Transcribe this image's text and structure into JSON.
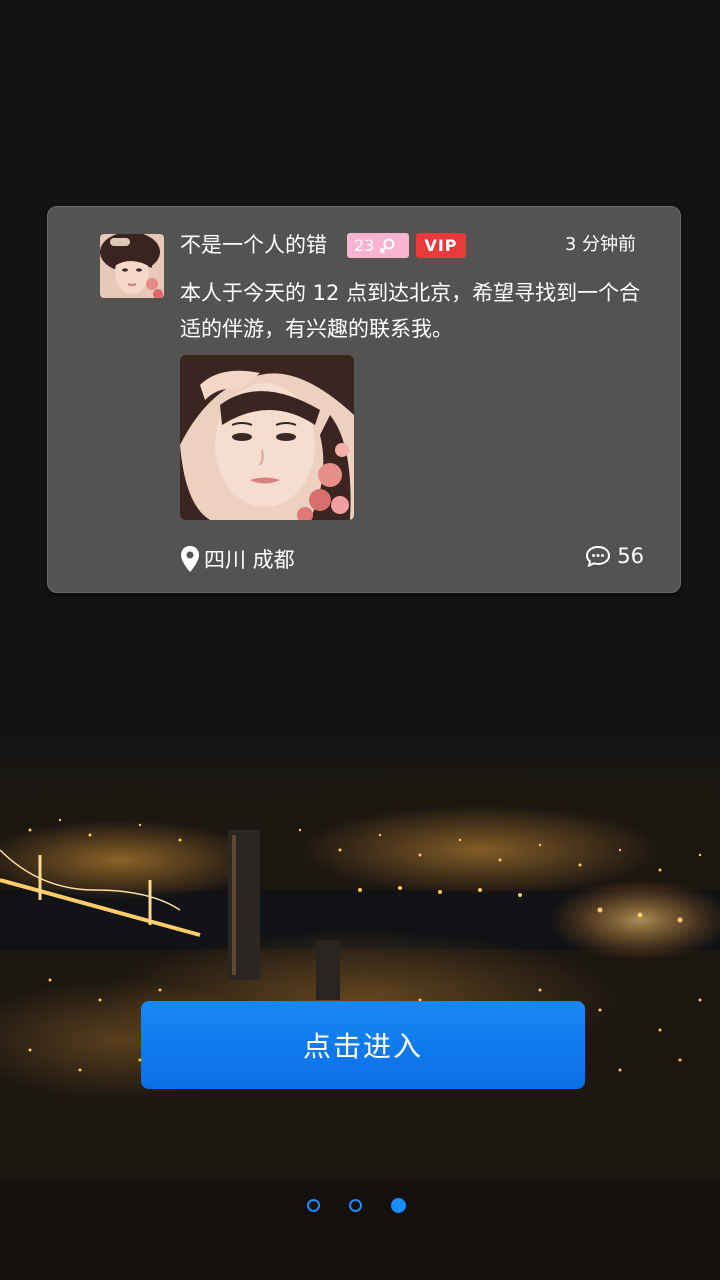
{
  "post": {
    "username": "不是一个人的错",
    "age": "23",
    "vip_label": "VIP",
    "time": "3 分钟前",
    "content": "本人于今天的 12 点到达北京，希望寻找到一个合适的伴游，有兴趣的联系我。",
    "location": "四川  成都",
    "comment_count": "56"
  },
  "colors": {
    "card_bg": "#545352",
    "age_badge": "#f7b3d0",
    "vip_badge": "#e8393b",
    "button": "#0a78ee",
    "dot": "#1a8cff"
  },
  "enter_button": {
    "label": "点击进入"
  },
  "pager": {
    "total": 3,
    "active_index": 2
  },
  "icons": {
    "gender": "female-icon",
    "location": "location-pin-icon",
    "comments": "comment-bubble-icon"
  }
}
